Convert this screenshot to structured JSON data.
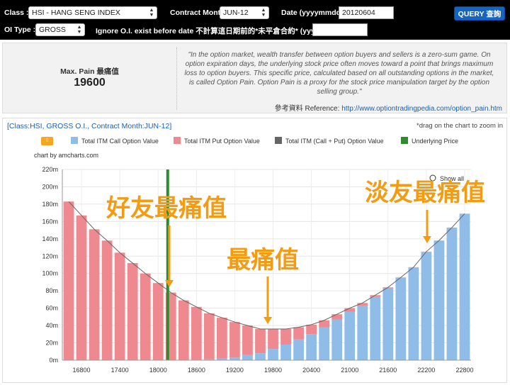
{
  "toolbar": {
    "class_label": "Class :",
    "class_value": "HSI - HANG SENG INDEX",
    "contract_label": "Contract Month :",
    "contract_value": "JUN-12",
    "date_label": "Date (yyyymmdd) :",
    "date_value": "20120604",
    "query_label": "QUERY 查詢",
    "oitype_label": "OI Type :",
    "oitype_value": "GROSS",
    "ignore_label": "Ignore O.I. exist before date 不計算這日期前的*未平倉合約* (yyyymmdd) :",
    "ignore_value": ""
  },
  "info": {
    "maxpain_label": "Max. Pain 最痛值",
    "maxpain_value": "19600",
    "quote": "\"In the option market, wealth transfer between option buyers and sellers is a zero-sum game. On option expiration days, the underlying stock price often moves toward a point that brings maximum loss to option buyers. This specific price, calculated based on all outstanding options in the market, is called Option Pain. Option Pain is a proxy for the stock price manipulation target by the option selling group.\"",
    "ref_label": "參考資料 Reference:",
    "ref_url": "http://www.optiontradingpedia.com/option_pain.htm"
  },
  "chart_header": {
    "title": "[Class:HSI, GROSS O.I., Contract Month:JUN-12]",
    "drag_hint": "*drag on the chart to zoom in",
    "credit": "chart by amcharts.com",
    "show_all": "Show all"
  },
  "colors": {
    "call": "#90bde8",
    "put": "#ee8a8f",
    "total_line": "#666666",
    "underlying": "#2e8b2e",
    "annotation": "#f39c12"
  },
  "chart_data": {
    "type": "bar",
    "stacked": true,
    "legend": [
      {
        "name": "Total ITM Call Option Value",
        "color": "#90bde8"
      },
      {
        "name": "Total ITM Put Option Value",
        "color": "#ee8a8f"
      },
      {
        "name": "Total ITM (Call + Put) Option Value",
        "color": "#666666"
      },
      {
        "name": "Underlying Price",
        "color": "#2e8b2e"
      }
    ],
    "x": [
      16600,
      16800,
      17000,
      17200,
      17400,
      17600,
      17800,
      18000,
      18200,
      18400,
      18600,
      18800,
      19000,
      19200,
      19400,
      19600,
      19800,
      20000,
      20200,
      20400,
      20600,
      20800,
      21000,
      21200,
      21400,
      21600,
      21800,
      22000,
      22200,
      22400,
      22600,
      22800
    ],
    "x_ticks": [
      16800,
      17400,
      18000,
      18600,
      19200,
      19800,
      20400,
      21000,
      21600,
      22200,
      22800
    ],
    "y_ticks": [
      0,
      20,
      40,
      60,
      80,
      100,
      120,
      140,
      160,
      180,
      200,
      220
    ],
    "y_tick_labels": [
      "0m",
      "20m",
      "40m",
      "60m",
      "80m",
      "100m",
      "120m",
      "140m",
      "160m",
      "180m",
      "200m",
      "220m"
    ],
    "ylim": [
      0,
      220
    ],
    "series": [
      {
        "name": "Total ITM Put Option Value",
        "values": [
          183,
          167,
          151,
          138,
          124,
          112,
          100,
          89,
          78,
          69,
          61,
          53,
          47,
          41,
          34,
          28,
          23,
          18,
          14,
          11,
          8,
          6,
          4,
          3,
          2,
          1,
          0.5,
          0.3,
          0.2,
          0.1,
          0,
          0
        ]
      },
      {
        "name": "Total ITM Call Option Value",
        "values": [
          0,
          0,
          0,
          0,
          0,
          0,
          0,
          0,
          0,
          0,
          0.5,
          1,
          2,
          3,
          6,
          8,
          13,
          18,
          24,
          30,
          38,
          47,
          56,
          63,
          73,
          83,
          95,
          107,
          125,
          138,
          153,
          169
        ]
      }
    ],
    "total": [
      183,
      167,
      151,
      138,
      124,
      112,
      100,
      89,
      78,
      69,
      61.5,
      54,
      49,
      44,
      40,
      36,
      36,
      36,
      38,
      41,
      46,
      53,
      60,
      66,
      75,
      84,
      95.5,
      107.3,
      125.2,
      138.1,
      153,
      169
    ],
    "underlying_price": 18150,
    "annotations": [
      {
        "text": "好友最痛值",
        "x": 18000
      },
      {
        "text": "最痛值",
        "x": 19600
      },
      {
        "text": "淡友最痛值",
        "x": 22200
      }
    ]
  }
}
